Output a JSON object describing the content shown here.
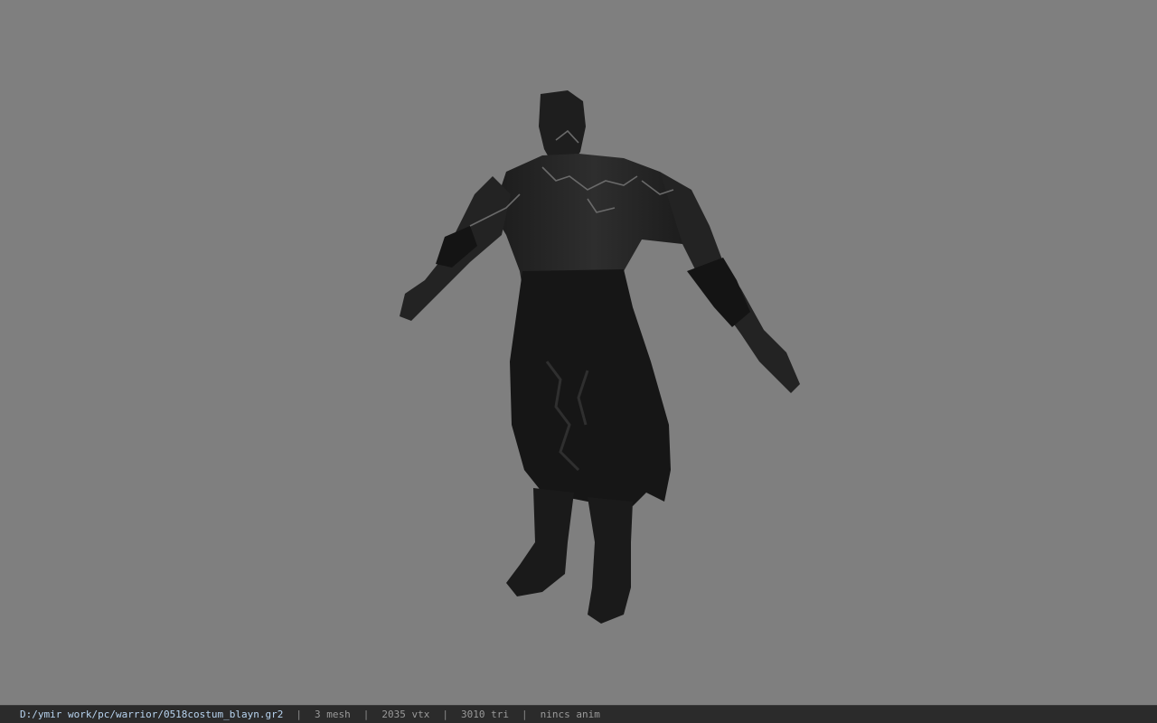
{
  "viewport": {
    "background": "#7f7f7f",
    "model_description": "character-model-warrior"
  },
  "status_bar": {
    "path": "D:/ymir work/pc/warrior/0518costum_blayn.gr2",
    "separator": "|",
    "mesh": "3 mesh",
    "vertices": "2035 vtx",
    "triangles": "3010 tri",
    "animation": "nincs anim"
  },
  "colors": {
    "status_bar_bg": "#2b2b2b",
    "path_text": "#b8d4f0",
    "info_text": "#9a9a9a"
  }
}
